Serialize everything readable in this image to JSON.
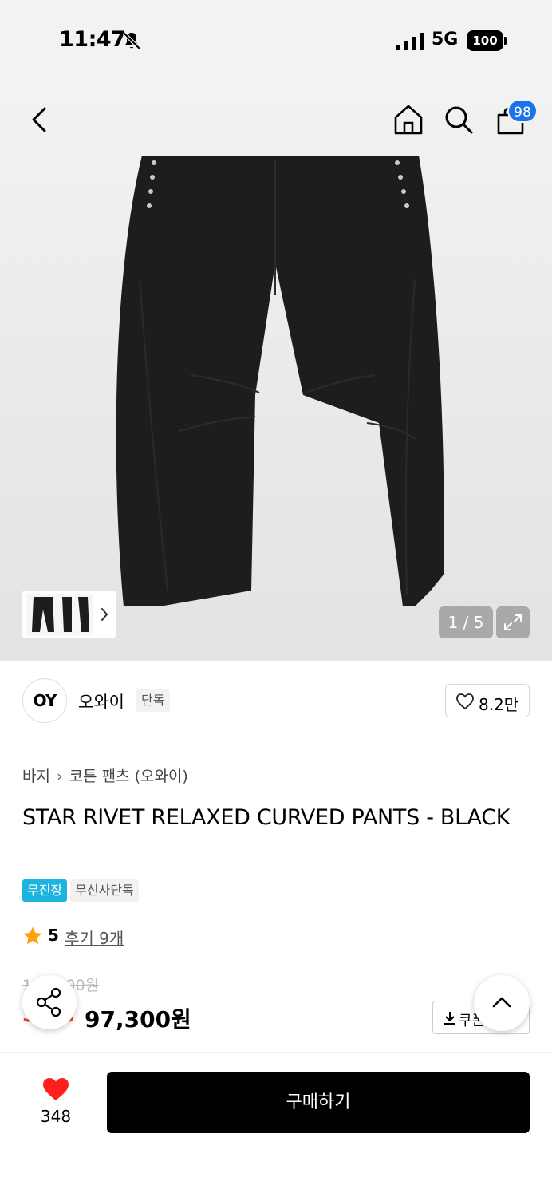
{
  "status_bar": {
    "time": "11:47",
    "network": "5G",
    "battery": "100"
  },
  "header": {
    "cart_count": "98"
  },
  "gallery": {
    "counter": "1 / 5",
    "colors": {
      "pants": "#1d1d1f",
      "background": "#ececec"
    }
  },
  "brand": {
    "logo_text": "OY",
    "name": "오와이",
    "tag": "단독",
    "likes": "8.2만"
  },
  "product": {
    "breadcrumb": [
      "바지",
      "코튼 팬츠 (오와이)"
    ],
    "title": "STAR RIVET RELAXED CURVED PANTS - BLACK",
    "tags": [
      "무진장",
      "무신사단독"
    ],
    "rating": "5",
    "review_link": "후기 9개",
    "original_price": "139,000원",
    "discount": "30%",
    "price": "97,300원",
    "coupon_label": "쿠폰"
  },
  "bottom_bar": {
    "wish_count": "348",
    "buy_label": "구매하기"
  },
  "colors": {
    "accent_blue": "#1a73e8",
    "tag_blue": "#1db4e0",
    "discount_red": "#ff3b30",
    "heart_red": "#ff1e1e",
    "star": "#ff9f0a"
  }
}
